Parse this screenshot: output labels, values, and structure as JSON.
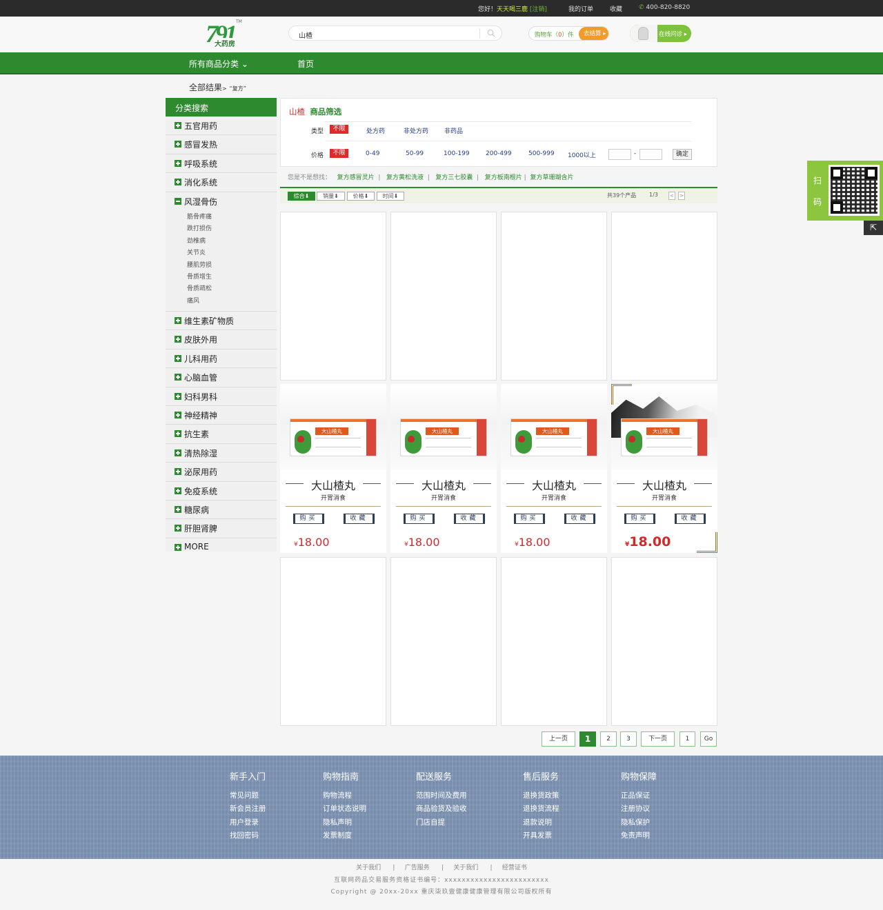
{
  "topbar": {
    "greeting": "您好！",
    "username": "天天喝三鹿",
    "logout": "[注销]",
    "orders": "我的订单",
    "favorites": "收藏",
    "phone": "400-820-8820"
  },
  "logo": {
    "number": "791",
    "text": "大药房",
    "tm": "TM"
  },
  "search": {
    "value": "山楂"
  },
  "cart": {
    "label_pre": "购物车（",
    "count": "0",
    "label_post": "）件",
    "checkout": "去结算"
  },
  "consult": {
    "label": "在线问诊"
  },
  "nav": {
    "all_categories": "所有商品分类",
    "home": "首页"
  },
  "breadcrumb": {
    "root": "全部结果",
    "sep": ">",
    "keyword": "“复方”"
  },
  "sidebar": {
    "title": "分类搜索",
    "items": [
      "五官用药",
      "感冒发热",
      "呼吸系统",
      "消化系统",
      "风湿骨伤",
      "维生素矿物质",
      "皮肤外用",
      "儿科用药",
      "心脑血管",
      "妇科男科",
      "神经精神",
      "抗生素",
      "清热除湿",
      "泌尿用药",
      "免疫系统",
      "糖尿病",
      "肝胆肾脾",
      "MORE"
    ],
    "expanded_sub": [
      "筋骨疼痛",
      "跌打损伤",
      "劲椎病",
      "关节炎",
      "腰肌劳损",
      "骨质增生",
      "骨质疏松",
      "痛风"
    ]
  },
  "filter": {
    "keyword": "山楂",
    "title": "商品筛选",
    "type_label": "类型",
    "type_all": "不限",
    "types": [
      "处方药",
      "非处方药",
      "非药品"
    ],
    "price_label": "价格",
    "price_all": "不限",
    "prices": [
      "0-49",
      "50-99",
      "100-199",
      "200-499",
      "500-999",
      "1000以上"
    ],
    "range_sep": "-",
    "confirm": "确定"
  },
  "suggest": {
    "prefix": "您是不是想找：",
    "items": [
      "复方感冒灵片",
      "复方黄松洗液",
      "复方三七胶囊",
      "复方板南根片",
      "复方草珊瑚含片"
    ],
    "sep": "|"
  },
  "sort": {
    "buttons": [
      "综合⬇",
      "销量⬇",
      "价格⬇",
      "时间⬇"
    ],
    "count": "共39个产品",
    "page": "1/3",
    "prev": "<",
    "next": ">"
  },
  "products": [
    {
      "box_label": "大山楂丸",
      "name": "大山楂丸",
      "desc": "开胃消食",
      "buy": "购买",
      "fav": "收藏",
      "currency": "¥",
      "price": "18.00"
    },
    {
      "box_label": "大山楂丸",
      "name": "大山楂丸",
      "desc": "开胃消食",
      "buy": "购买",
      "fav": "收藏",
      "currency": "¥",
      "price": "18.00"
    },
    {
      "box_label": "大山楂丸",
      "name": "大山楂丸",
      "desc": "开胃消食",
      "buy": "购买",
      "fav": "收藏",
      "currency": "¥",
      "price": "18.00"
    },
    {
      "box_label": "大山楂丸",
      "name": "大山楂丸",
      "desc": "开胃消食",
      "buy": "购买",
      "fav": "收藏",
      "currency": "¥",
      "price": "18.00"
    }
  ],
  "pagination": {
    "prev": "上一页",
    "pages": [
      "1",
      "2",
      "3"
    ],
    "next": "下一页",
    "jump": "1",
    "go": "Go"
  },
  "qr": {
    "line1": "扫",
    "line2": "码",
    "top": "⇱"
  },
  "footer": {
    "cols": [
      {
        "title": "新手入门",
        "items": [
          "常见问题",
          "新会员注册",
          "用户登录",
          "找回密码"
        ]
      },
      {
        "title": "购物指南",
        "items": [
          "购物流程",
          "订单状态说明",
          "隐私声明",
          "发票制度"
        ]
      },
      {
        "title": "配送服务",
        "items": [
          "范围时间及费用",
          "商品验货及验收",
          "门店自提"
        ]
      },
      {
        "title": "售后服务",
        "items": [
          "退换货政策",
          "退换货流程",
          "退款说明",
          "开具发票"
        ]
      },
      {
        "title": "购物保障",
        "items": [
          "正品保证",
          "注册协议",
          "隐私保护",
          "免责声明"
        ]
      }
    ],
    "links": [
      "关于我们",
      "广告服务",
      "关于我们",
      "经营证书"
    ],
    "link_sep": "|",
    "license": "互联网药品交易服务资格证书编号：xxxxxxxxxxxxxxxxxxxxxxxx",
    "copyright": "Copyright @ 20xx-20xx 重庆柒玖壹健康健康管理有限公司版权所有"
  },
  "colors": {
    "brand_green": "#2d8a2f",
    "price_red": "#d02a2a",
    "footer_blue": "#7e94b4",
    "qr_green": "#8cc63f"
  }
}
